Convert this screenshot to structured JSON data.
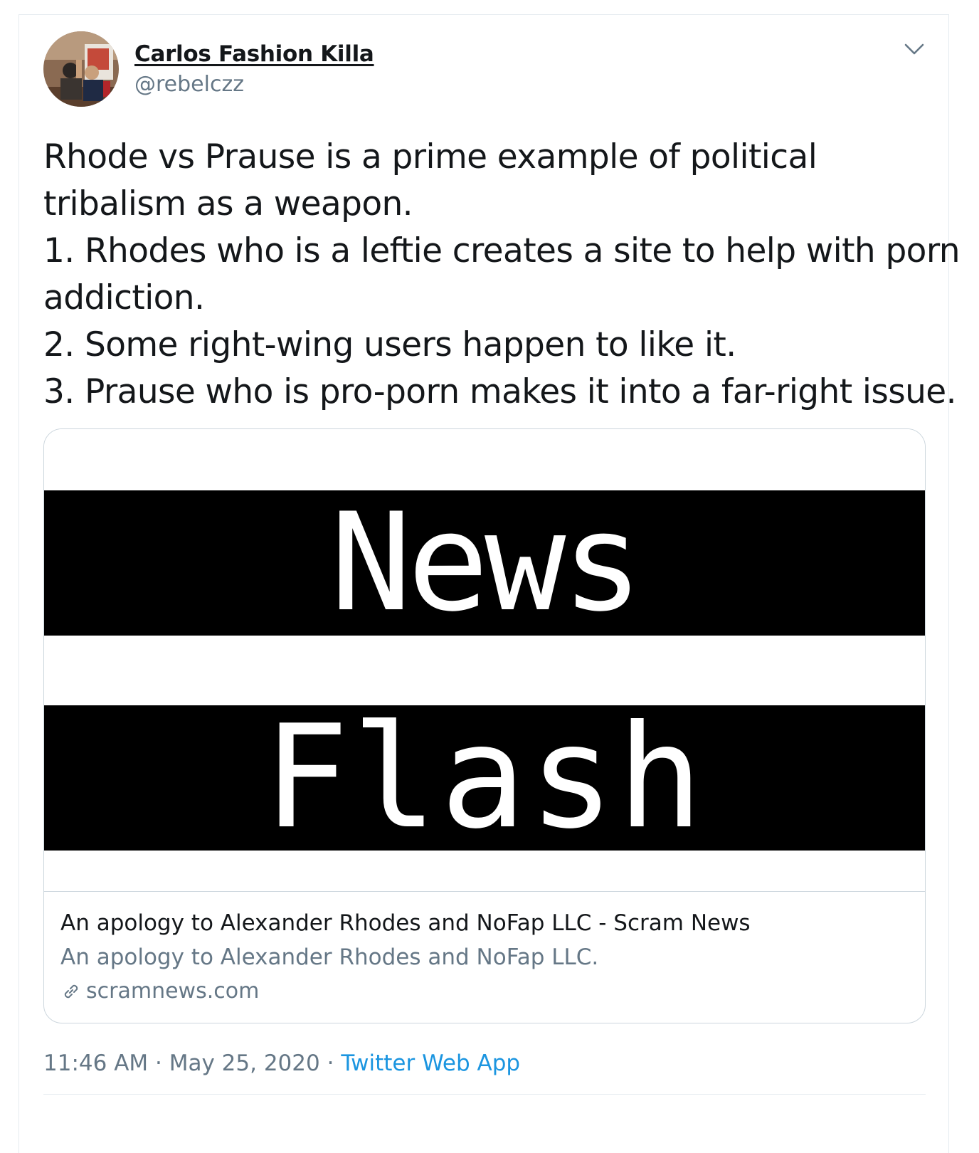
{
  "tweet": {
    "author": {
      "display_name": "Carlos Fashion Killa",
      "handle": "@rebelczz",
      "avatar_icon": "user-avatar-photo"
    },
    "text_lines": [
      "Rhode vs Prause is a prime example of political",
      "tribalism as a weapon.",
      "1. Rhodes who is a leftie creates a site to help with porn",
      "addiction.",
      "2. Some right-wing users happen to like it.",
      "3. Prause who is pro-porn makes it into a far-right issue."
    ],
    "card": {
      "image_text_top": "News",
      "image_text_bottom": "Flash",
      "title": "An apology to Alexander Rhodes and NoFap LLC - Scram News",
      "description": "An apology to Alexander Rhodes and NoFap LLC.",
      "domain": "scramnews.com",
      "domain_icon": "link-icon"
    },
    "meta": {
      "time": "11:46 AM",
      "separator": "·",
      "date": "May 25, 2020",
      "source": "Twitter Web App"
    },
    "menu_icon": "chevron-down-icon"
  },
  "colors": {
    "text_primary": "#14171a",
    "text_secondary": "#657786",
    "link_blue": "#1b95e0",
    "border": "#ccd6dd"
  }
}
